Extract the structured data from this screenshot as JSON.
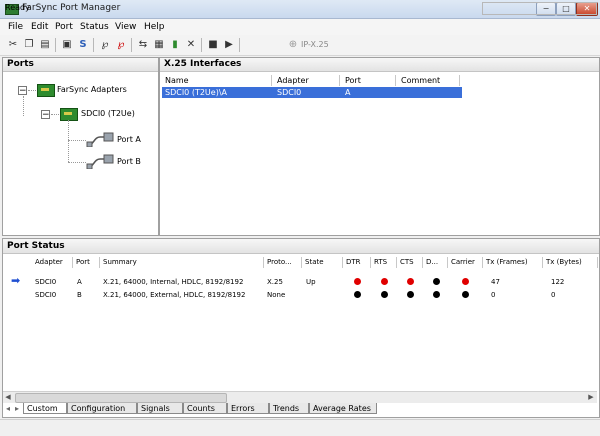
{
  "window": {
    "title": "FarSync Port Manager",
    "controls": {
      "minimize": "−",
      "maximize": "□",
      "close": "✕"
    }
  },
  "menu": [
    "File",
    "Edit",
    "Port",
    "Status",
    "View",
    "Help"
  ],
  "toolbar": {
    "ipx25_label": "IP-X.25"
  },
  "ports_pane": {
    "title": "Ports",
    "tree": {
      "root": "FarSync Adapters",
      "adapter": "SDCI0 (T2Ue)",
      "ports": [
        "Port A",
        "Port B"
      ]
    }
  },
  "interfaces_pane": {
    "title": "X.25 Interfaces",
    "columns": [
      "Name",
      "Adapter",
      "Port",
      "Comment"
    ],
    "rows": [
      {
        "name": "SDCI0 (T2Ue)\\A",
        "adapter": "SDCI0",
        "port": "A",
        "comment": ""
      }
    ]
  },
  "port_status": {
    "title": "Port Status",
    "columns": [
      "Adapter",
      "Port",
      "Summary",
      "Proto...",
      "State",
      "DTR",
      "RTS",
      "CTS",
      "D...",
      "Carrier",
      "Tx (Frames)",
      "Tx (Bytes)"
    ],
    "rows": [
      {
        "adapter": "SDCI0",
        "port": "A",
        "summary": "X.21, 64000, Internal, HDLC, 8192/8192",
        "proto": "X.25",
        "state": "Up",
        "signals": [
          "red",
          "red",
          "red",
          "black",
          "red"
        ],
        "tx_frames": "47",
        "tx_bytes": "122"
      },
      {
        "adapter": "SDCI0",
        "port": "B",
        "summary": "X.21, 64000, External, HDLC, 8192/8192",
        "proto": "None",
        "state": "",
        "signals": [
          "black",
          "black",
          "black",
          "black",
          "black"
        ],
        "tx_frames": "0",
        "tx_bytes": "0"
      }
    ]
  },
  "tabs": [
    "Custom",
    "Configuration",
    "Signals",
    "Counts",
    "Errors",
    "Trends",
    "Average Rates"
  ],
  "statusbar": {
    "text": "Ready"
  },
  "colors": {
    "selection": "#3a6fd9",
    "signal_red": "#e00000",
    "signal_black": "#000000"
  }
}
